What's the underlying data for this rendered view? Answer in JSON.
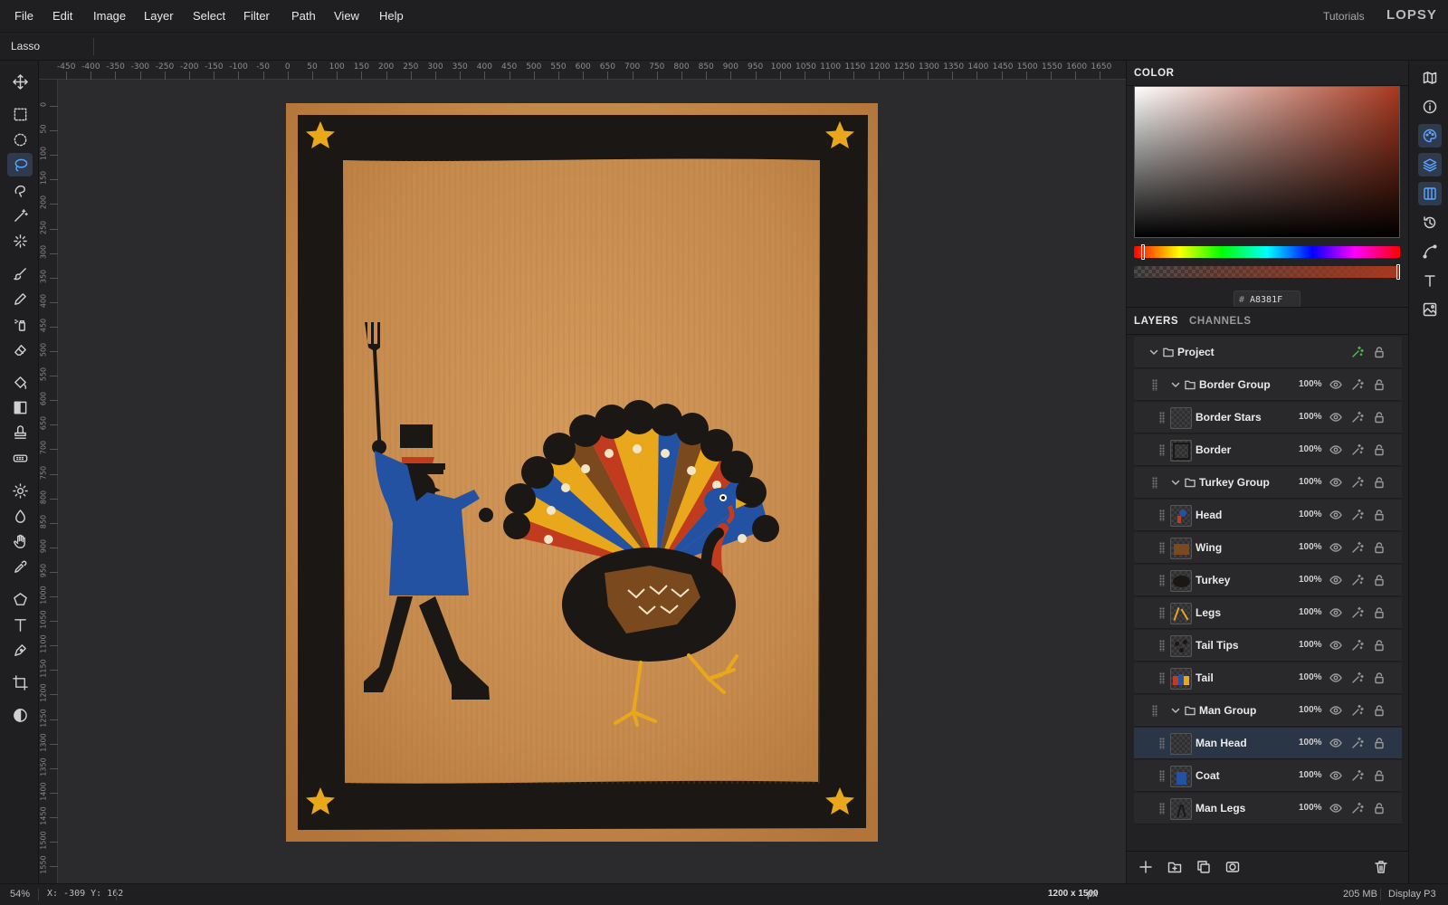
{
  "menubar": {
    "items": [
      "File",
      "Edit",
      "Image",
      "Layer",
      "Select",
      "Filter",
      "Path",
      "View",
      "Help"
    ],
    "tutorials": "Tutorials",
    "logo": "LOPSY"
  },
  "options": {
    "tool_name": "Lasso"
  },
  "toolbar": {
    "tools": [
      "move-tool-icon",
      "rect-select-icon",
      "ellipse-select-icon",
      "lasso-icon",
      "quick-select-icon",
      "magic-wand-icon",
      "object-select-icon",
      "brush-icon",
      "pencil-icon",
      "spray-icon",
      "eraser-icon",
      "paint-bucket-icon",
      "gradient-icon",
      "clone-stamp-icon",
      "healing-icon",
      "dodge-icon",
      "blur-icon",
      "hand-icon",
      "eyedropper-icon",
      "polygon-icon",
      "text-icon",
      "pen-icon",
      "crop-icon",
      "contrast-icon"
    ],
    "active": "lasso-icon"
  },
  "rulers": {
    "top": [
      "-450",
      "-400",
      "-350",
      "-300",
      "-250",
      "-200",
      "-150",
      "-100",
      "-50",
      "0",
      "50",
      "100",
      "150",
      "200",
      "250",
      "300",
      "350",
      "400",
      "450",
      "500",
      "550",
      "600",
      "650",
      "700",
      "750",
      "800",
      "850",
      "900",
      "950",
      "1000",
      "1050",
      "1100",
      "1150",
      "1200",
      "1250",
      "1300",
      "1350",
      "1400",
      "1450",
      "1500",
      "1550",
      "1600",
      "1650"
    ],
    "left": [
      "0",
      "50",
      "100",
      "150",
      "200",
      "250",
      "300",
      "350",
      "400",
      "450",
      "500",
      "550",
      "600",
      "650",
      "700",
      "750",
      "800",
      "850",
      "900",
      "950",
      "1000",
      "1050",
      "1100",
      "1150",
      "1200",
      "1250",
      "1300",
      "1350",
      "1400",
      "1450",
      "1500",
      "1550"
    ]
  },
  "color_panel": {
    "title": "COLOR",
    "hash": "#",
    "hex": "A8381F",
    "current_color": "#a8381f"
  },
  "layers_panel": {
    "tab_layers": "LAYERS",
    "tab_channels": "CHANNELS",
    "layers": [
      {
        "name": "Project",
        "opacity": "",
        "type": "group",
        "depth": 0
      },
      {
        "name": "Border Group",
        "opacity": "100%",
        "type": "group",
        "depth": 1
      },
      {
        "name": "Border Stars",
        "opacity": "100%",
        "type": "layer",
        "depth": 2
      },
      {
        "name": "Border",
        "opacity": "100%",
        "type": "layer",
        "depth": 2
      },
      {
        "name": "Turkey Group",
        "opacity": "100%",
        "type": "group",
        "depth": 1
      },
      {
        "name": "Head",
        "opacity": "100%",
        "type": "layer",
        "depth": 2
      },
      {
        "name": "Wing",
        "opacity": "100%",
        "type": "layer",
        "depth": 2
      },
      {
        "name": "Turkey",
        "opacity": "100%",
        "type": "layer",
        "depth": 2
      },
      {
        "name": "Legs",
        "opacity": "100%",
        "type": "layer",
        "depth": 2
      },
      {
        "name": "Tail Tips",
        "opacity": "100%",
        "type": "layer",
        "depth": 2
      },
      {
        "name": "Tail",
        "opacity": "100%",
        "type": "layer",
        "depth": 2
      },
      {
        "name": "Man Group",
        "opacity": "100%",
        "type": "group",
        "depth": 1
      },
      {
        "name": "Man Head",
        "opacity": "100%",
        "type": "layer",
        "depth": 2,
        "selected": true
      },
      {
        "name": "Coat",
        "opacity": "100%",
        "type": "layer",
        "depth": 2
      },
      {
        "name": "Man Legs",
        "opacity": "100%",
        "type": "layer",
        "depth": 2
      }
    ]
  },
  "status": {
    "zoom": "54%",
    "coords": "X: -309 Y: 162",
    "doc_size": "1200 x 1500",
    "doc_unit": "px",
    "memory": "205 MB",
    "color_profile": "Display P3"
  }
}
